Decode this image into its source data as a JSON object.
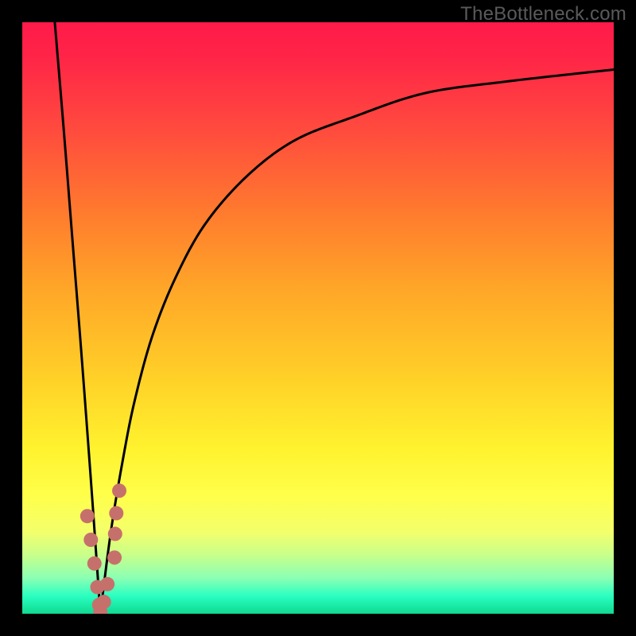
{
  "watermark": "TheBottleneck.com",
  "colors": {
    "frame": "#000000",
    "curve": "#000000",
    "marker": "#c6706c",
    "gradient_top": "#ff1a4a",
    "gradient_bottom": "#13d892"
  },
  "chart_data": {
    "type": "line",
    "title": "",
    "xlabel": "",
    "ylabel": "",
    "xlim": [
      0,
      100
    ],
    "ylim": [
      0,
      100
    ],
    "note": "Axes are unlabeled; values estimated from pixel positions on a 0–100 normalized grid (origin bottom-left). Two black curves form a V-shaped dip near x≈13 reaching y≈0, with an asymptotic rise toward y≈92 on the right. Pink markers cluster near the dip.",
    "series": [
      {
        "name": "left-curve",
        "x": [
          5.5,
          7,
          8.5,
          10,
          11.5,
          12.5,
          13.2
        ],
        "y": [
          100,
          82,
          63,
          44,
          24,
          10,
          0
        ]
      },
      {
        "name": "right-curve",
        "x": [
          13.2,
          15,
          17,
          19,
          22,
          26,
          31,
          38,
          46,
          56,
          68,
          82,
          100
        ],
        "y": [
          0,
          14,
          26,
          36,
          47,
          57,
          66,
          74,
          80,
          84,
          88,
          90,
          92
        ]
      }
    ],
    "markers": [
      {
        "x": 11.0,
        "y": 16.5
      },
      {
        "x": 11.6,
        "y": 12.5
      },
      {
        "x": 12.2,
        "y": 8.5
      },
      {
        "x": 12.7,
        "y": 4.5
      },
      {
        "x": 13.0,
        "y": 1.5
      },
      {
        "x": 13.2,
        "y": 0.3
      },
      {
        "x": 13.8,
        "y": 2.0
      },
      {
        "x": 14.4,
        "y": 5.0
      },
      {
        "x": 15.6,
        "y": 9.5
      },
      {
        "x": 15.7,
        "y": 13.5
      },
      {
        "x": 15.9,
        "y": 17.0
      },
      {
        "x": 16.4,
        "y": 20.8
      }
    ]
  }
}
